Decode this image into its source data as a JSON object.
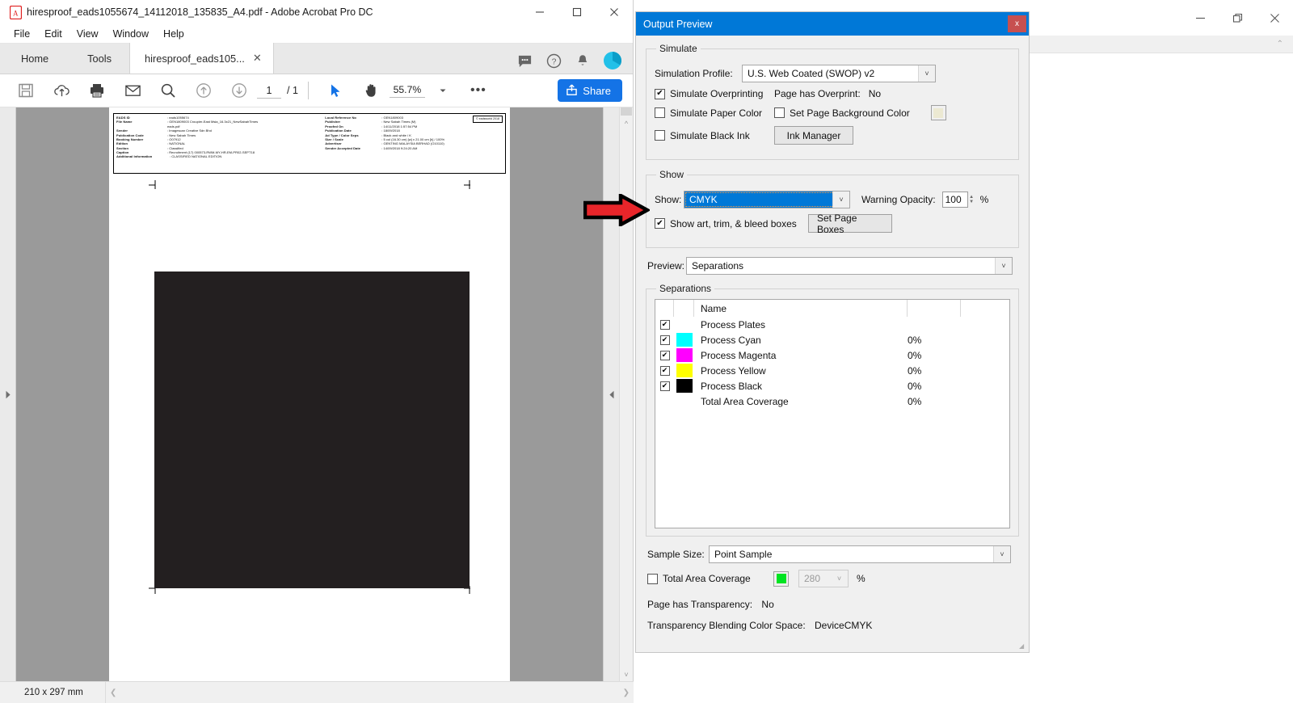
{
  "acrobat": {
    "title": "hiresproof_eads1055674_14112018_135835_A4.pdf - Adobe Acrobat Pro DC",
    "window_controls": {
      "minimize": "—",
      "maximize": "☐",
      "close": "✕"
    },
    "menu": [
      "File",
      "Edit",
      "View",
      "Window",
      "Help"
    ],
    "tabs": {
      "home": "Home",
      "tools": "Tools",
      "document": "hiresproof_eads105...",
      "close_tab": "✕"
    },
    "toolbar": {
      "page_current": "1",
      "page_total": "/ 1",
      "zoom": "55.7%",
      "zoom_caret": "▼",
      "more": "•••",
      "share": "Share"
    },
    "status": {
      "dimensions": "210 x 297 mm"
    }
  },
  "pdf": {
    "copyright": "© eadsworld 2018",
    "left_fields": [
      {
        "key": "EADS ID",
        "value": ": eads1055674"
      },
      {
        "key": "File Name",
        "value": ": GEN1809003 Croupier-East Msia_16.3x21_NewSabahTimes",
        "cont": "eads.pdf"
      },
      {
        "key": "Sender",
        "value": ": Imagescan Creative Sdn Bhd"
      },
      {
        "key": "Publication Code",
        "value": ": New Sabah Times"
      },
      {
        "key": "Booking Number",
        "value": ": O07912"
      },
      {
        "key": "Edition",
        "value": ": NATIONAL"
      },
      {
        "key": "Section",
        "value": ": Classified"
      },
      {
        "key": "Caption",
        "value": ": Recruitment (17) 000573-RWM-MY-HR-EM-PR02-SEPT18"
      },
      {
        "key": "Additional Information",
        "value": ": CLASSIFIED NATIONAL EDITION"
      }
    ],
    "right_fields": [
      {
        "key": "Local Reference No",
        "value": ": GEN1809003"
      },
      {
        "key": "Publisher",
        "value": ": New Sabah Times (M)"
      },
      {
        "key": "Proofed On",
        "value": ": 14/11/2018 1:57:54 PM"
      },
      {
        "key": "Publication Date",
        "value": ": 18/09/2018"
      },
      {
        "key": "Ad Type / Color Seps",
        "value": ": Black and white / K"
      },
      {
        "key": "Size / Scale",
        "value": ": 5 col (16.30 cm) [w] x 21.00 cm [h] / 100%"
      },
      {
        "key": "Advertiser",
        "value": ": GENTING MALAYSIA BERHAD (O10110)"
      },
      {
        "key": "Sender Accepted Date",
        "value": ": 14/09/2018 9:24:20 AM"
      }
    ],
    "artwork_color": "#231f20"
  },
  "output_preview": {
    "title": "Output Preview",
    "close_label": "x",
    "simulate": {
      "legend": "Simulate",
      "profile_label": "Simulation Profile:",
      "profile_value": "U.S. Web Coated (SWOP) v2",
      "simulate_overprinting": {
        "label": "Simulate Overprinting",
        "checked": "✔"
      },
      "page_has_overprint_label": "Page has Overprint:",
      "page_has_overprint_value": "No",
      "simulate_paper_color": {
        "label": "Simulate Paper Color",
        "checked": ""
      },
      "set_page_background_color": {
        "label": "Set Page Background Color",
        "checked": ""
      },
      "background_swatch_color": "#ece9d2",
      "simulate_black_ink": {
        "label": "Simulate Black Ink",
        "checked": ""
      },
      "ink_manager": "Ink Manager"
    },
    "show": {
      "legend": "Show",
      "show_label": "Show:",
      "show_value": "CMYK",
      "warning_opacity_label": "Warning Opacity:",
      "warning_opacity_value": "100",
      "percent": "%",
      "show_boxes": {
        "label": "Show art, trim, & bleed boxes",
        "checked": "✔"
      },
      "set_page_boxes": "Set Page Boxes"
    },
    "preview": {
      "label": "Preview:",
      "value": "Separations"
    },
    "separations": {
      "legend": "Separations",
      "columns": [
        "",
        "",
        "Name",
        "",
        ""
      ],
      "rows": [
        {
          "checked": "✔",
          "swatch": "",
          "name": "Process Plates",
          "value": ""
        },
        {
          "checked": "✔",
          "swatch": "#00ffff",
          "name": "Process Cyan",
          "value": "0%"
        },
        {
          "checked": "✔",
          "swatch": "#ff00ff",
          "name": "Process Magenta",
          "value": "0%"
        },
        {
          "checked": "✔",
          "swatch": "#ffff00",
          "name": "Process Yellow",
          "value": "0%"
        },
        {
          "checked": "✔",
          "swatch": "#000000",
          "name": "Process Black",
          "value": "0%"
        },
        {
          "checked": "",
          "swatch": "",
          "name": "Total Area Coverage",
          "value": "0%"
        }
      ]
    },
    "sample_size": {
      "label": "Sample Size:",
      "value": "Point Sample"
    },
    "total_area_coverage": {
      "label": "Total Area Coverage",
      "checked": "",
      "swatch_color": "#00e422",
      "value": "280",
      "percent": "%"
    },
    "page_has_transparency": {
      "label": "Page has Transparency:",
      "value": "No"
    },
    "blending_space": {
      "label": "Transparency Blending Color Space:",
      "value": "DeviceCMYK"
    }
  },
  "outer_window": {
    "controls": {
      "minimize": "—",
      "restore": "❐",
      "close": "✕"
    },
    "collapse": "⌃"
  },
  "annotation": {
    "arrow_fill": "#e8252a",
    "arrow_stroke": "#000000"
  }
}
